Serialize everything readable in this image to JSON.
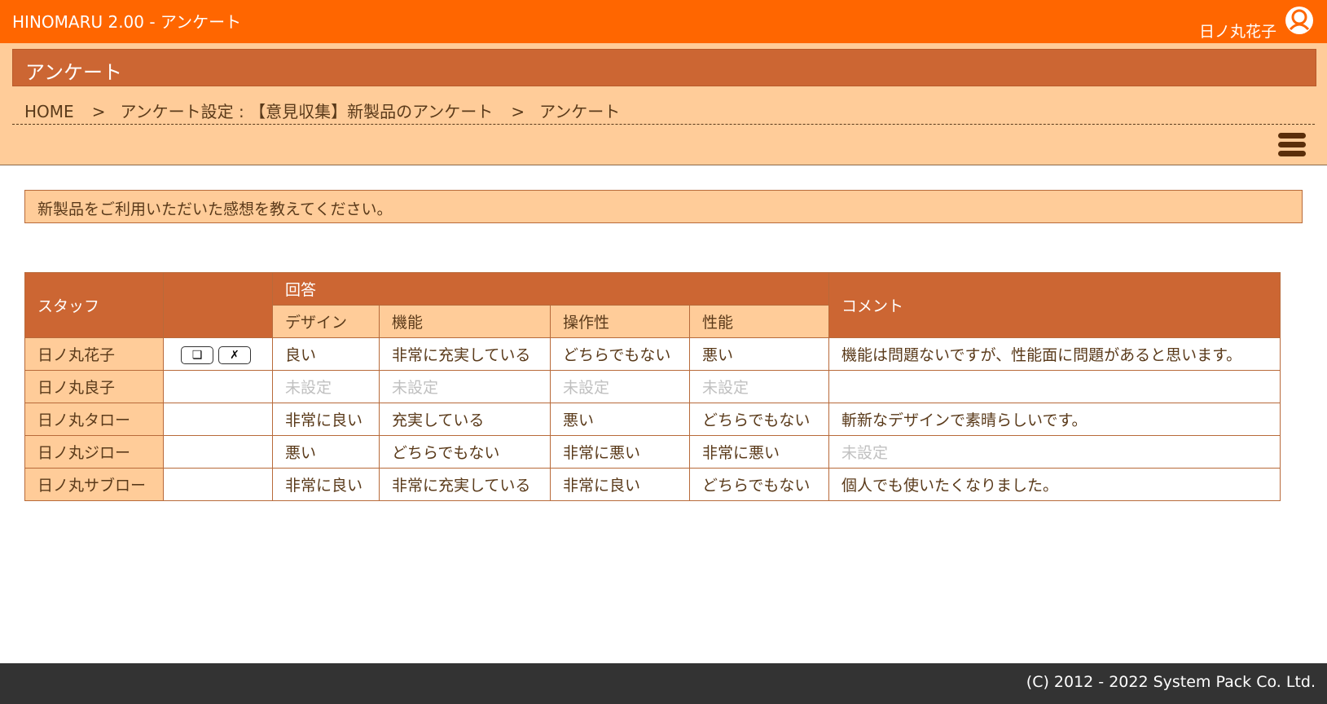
{
  "app": {
    "title": "HINOMARU 2.00 - アンケート"
  },
  "user": {
    "name": "日ノ丸花子",
    "avatar_icon": "user-icon"
  },
  "page": {
    "title": "アンケート"
  },
  "breadcrumb": [
    {
      "label": "HOME"
    },
    {
      "label": "アンケート設定 : 【意見収集】新製品のアンケート"
    },
    {
      "label": "アンケート"
    }
  ],
  "breadcrumb_separator": ">",
  "menu": {
    "icon": "hamburger-menu-icon"
  },
  "question": "新製品をご利用いただいた感想を教えてください。",
  "table": {
    "headers": {
      "staff": "スタッフ",
      "actions": "",
      "answers": "回答",
      "comment": "コメント"
    },
    "sub_headers": [
      "デザイン",
      "機能",
      "操作性",
      "性能"
    ],
    "action_buttons": {
      "edit": "❏",
      "delete": "✗"
    },
    "rows": [
      {
        "staff": "日ノ丸花子",
        "has_actions": true,
        "answers": [
          "良い",
          "非常に充実している",
          "どちらでもない",
          "悪い"
        ],
        "comment": "機能は問題ないですが、性能面に問題があると思います。"
      },
      {
        "staff": "日ノ丸良子",
        "has_actions": false,
        "answers": [
          "未設定",
          "未設定",
          "未設定",
          "未設定"
        ],
        "comment": ""
      },
      {
        "staff": "日ノ丸タロー",
        "has_actions": false,
        "answers": [
          "非常に良い",
          "充実している",
          "悪い",
          "どちらでもない"
        ],
        "comment": "斬新なデザインで素晴らしいです。"
      },
      {
        "staff": "日ノ丸ジロー",
        "has_actions": false,
        "answers": [
          "悪い",
          "どちらでもない",
          "非常に悪い",
          "非常に悪い"
        ],
        "comment": "未設定"
      },
      {
        "staff": "日ノ丸サブロー",
        "has_actions": false,
        "answers": [
          "非常に良い",
          "非常に充実している",
          "非常に良い",
          "どちらでもない"
        ],
        "comment": "個人でも使いたくなりました。"
      }
    ]
  },
  "unset_label": "未設定",
  "footer": {
    "copyright": "(C) 2012 - 2022 System Pack Co. Ltd."
  },
  "colors": {
    "topbar": "#ff6600",
    "accent_dark": "#cc6633",
    "accent_light": "#ffcc99",
    "footer": "#333333",
    "unset_text": "#c0c0c0"
  }
}
